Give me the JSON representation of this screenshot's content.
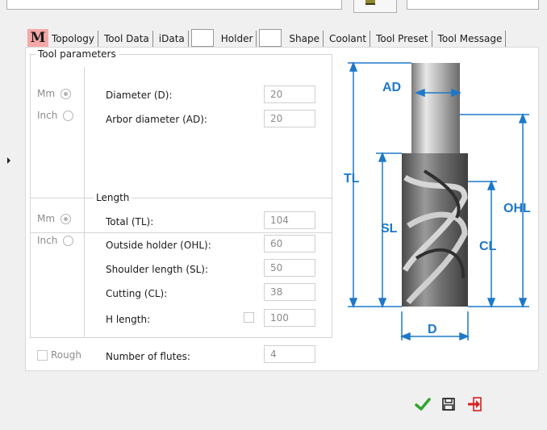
{
  "tabs": [
    "Topology",
    "Tool Data",
    "iData",
    "",
    "Holder",
    "",
    "Shape",
    "Coolant",
    "Tool Preset",
    "Tool Message"
  ],
  "tool_parameters": {
    "legend": "Tool parameters",
    "unit_mm": "Mm",
    "unit_inch": "Inch",
    "diameter_label": "Diameter (D):",
    "diameter_value": "20",
    "arbor_label": "Arbor diameter (AD):",
    "arbor_value": "20"
  },
  "length": {
    "legend": "Length",
    "unit_mm": "Mm",
    "unit_inch": "Inch",
    "total_label": "Total (TL):",
    "total_value": "104",
    "outside_label": "Outside holder (OHL):",
    "outside_value": "60",
    "shoulder_label": "Shoulder length (SL):",
    "shoulder_value": "50",
    "cutting_label": "Cutting (CL):",
    "cutting_value": "38",
    "h_label": "H length:",
    "h_value": "100"
  },
  "flutes": {
    "rough_label": "Rough",
    "label": "Number of flutes:",
    "value": "4"
  },
  "diagram": {
    "ad": "AD",
    "tl": "TL",
    "sl": "SL",
    "ohl": "OHL",
    "cl": "CL",
    "d": "D"
  },
  "colors": {
    "accent_blue": "#1e78c8",
    "tab_m_bg": "#f5a8a8",
    "ok_green": "#2fa52f",
    "exit_red": "#d42020"
  },
  "icons": [
    "m-logo-icon",
    "check-icon",
    "save-icon",
    "exit-icon"
  ]
}
